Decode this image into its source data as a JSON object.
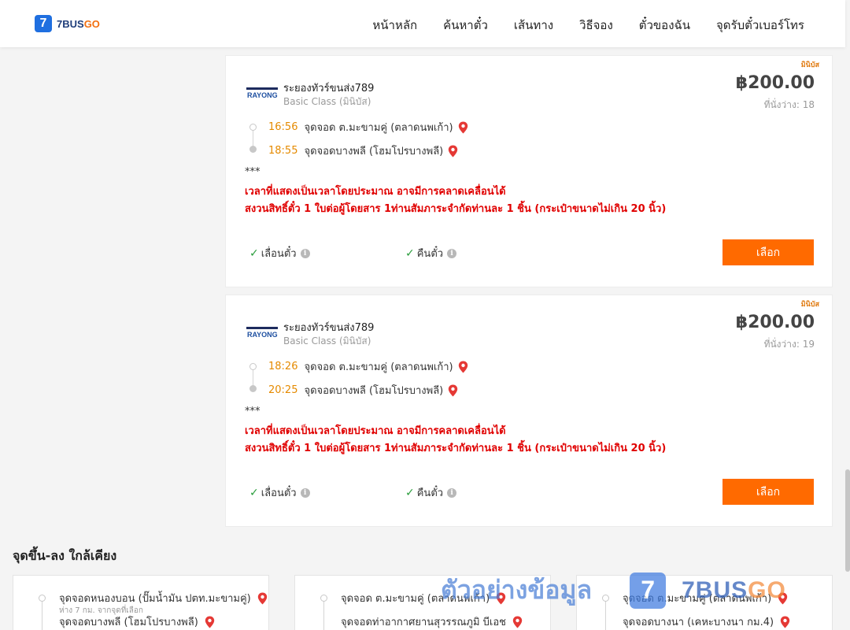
{
  "brand": {
    "logo_digit": "7",
    "logo_text_a": "7BUS",
    "logo_text_b": "GO"
  },
  "nav": [
    {
      "label": "หน้าหลัก"
    },
    {
      "label": "ค้นหาตั๋ว"
    },
    {
      "label": "เส้นทาง"
    },
    {
      "label": "วิธีจอง"
    },
    {
      "label": "ตั๋วของฉัน"
    },
    {
      "label": "จุดรับตั๋วเบอร์โทร"
    }
  ],
  "trips": [
    {
      "tag": "มินิบัส",
      "operator": "ระยองทัวร์ขนส่ง789",
      "operator_logo": "RAYONG",
      "class": "Basic Class (มินิบัส)",
      "price": "฿200.00",
      "seats": "ที่นั่งว่าง: 18",
      "departure_time": "16:56",
      "departure_place": "จุดจอด ต.มะขามคู่ (ตลาดนพเก้า)",
      "arrival_time": "18:55",
      "arrival_place": "จุดจอดบางพลี (โฮมโปรบางพลี)",
      "note_marker": "***",
      "notice_1": "เวลาที่แสดงเป็นเวลาโดยประมาณ อาจมีการคลาดเคลื่อนได้",
      "notice_2": "สงวนสิทธิ์ตั๋ว 1 ใบต่อผู้โดยสาร 1ท่านสัมภาระจำกัดท่านละ 1 ชิ้น (กระเป๋าขนาดไม่เกิน 20 นิ้ว)",
      "feature_1": "เลื่อนตั๋ว",
      "feature_2": "คืนตั๋ว",
      "select_label": "เลือก"
    },
    {
      "tag": "มินิบัส",
      "operator": "ระยองทัวร์ขนส่ง789",
      "operator_logo": "RAYONG",
      "class": "Basic Class (มินิบัส)",
      "price": "฿200.00",
      "seats": "ที่นั่งว่าง: 19",
      "departure_time": "18:26",
      "departure_place": "จุดจอด ต.มะขามคู่ (ตลาดนพเก้า)",
      "arrival_time": "20:25",
      "arrival_place": "จุดจอดบางพลี (โฮมโปรบางพลี)",
      "note_marker": "***",
      "notice_1": "เวลาที่แสดงเป็นเวลาโดยประมาณ อาจมีการคลาดเคลื่อนได้",
      "notice_2": "สงวนสิทธิ์ตั๋ว 1 ใบต่อผู้โดยสาร 1ท่านสัมภาระจำกัดท่านละ 1 ชิ้น (กระเป๋าขนาดไม่เกิน 20 นิ้ว)",
      "feature_1": "เลื่อนตั๋ว",
      "feature_2": "คืนตั๋ว",
      "select_label": "เลือก"
    }
  ],
  "nearby": {
    "title": "จุดขึ้น-ลง ใกล้เคียง",
    "cards": [
      {
        "from": "จุดจอดหนองบอน (ปั๊มน้ำมัน ปตท.มะขามคู่)",
        "distance": "ห่าง 7 กม. จากจุดที่เลือก",
        "to": "จุดจอดบางพลี (โฮมโปรบางพลี)"
      },
      {
        "from": "จุดจอด ต.มะขามคู่ (ตลาดนพเก้า)",
        "to": "จุดจอดท่าอากาศยานสุวรรณภูมิ บีเอช"
      },
      {
        "from": "จุดจอด ต.มะขามคู่ (ตลาดนพเก้า)",
        "to": "จุดจอดบางนา (เคหะบางนา กม.4)"
      }
    ]
  },
  "watermark": {
    "text": "ตัวอย่างข้อมูล",
    "digit": "7",
    "brand_a": "7BUS",
    "brand_b": "GO"
  },
  "colors": {
    "accent": "#ff6a00",
    "notice": "#e00000",
    "time": "#e58a00",
    "brand_blue": "#1f6fe0"
  }
}
